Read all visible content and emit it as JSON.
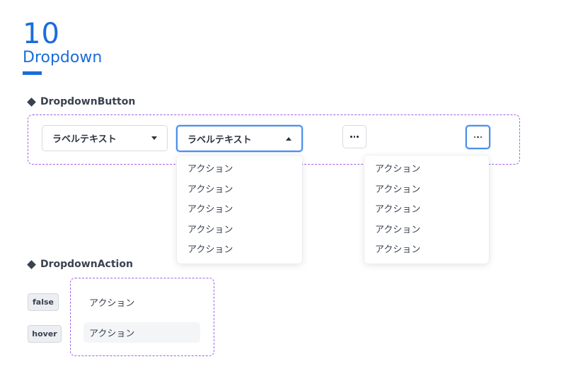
{
  "header": {
    "number": "10",
    "title": "Dropdown"
  },
  "sections": {
    "dropdown_button": {
      "heading": "DropdownButton"
    },
    "dropdown_action": {
      "heading": "DropdownAction"
    }
  },
  "dropdown_buttons": {
    "default": {
      "label": "ラベルテキスト",
      "state": "closed"
    },
    "open": {
      "label": "ラベルテキスト",
      "state": "open"
    }
  },
  "menus": {
    "label_menu": [
      "アクション",
      "アクション",
      "アクション",
      "アクション",
      "アクション"
    ],
    "more_menu": [
      "アクション",
      "アクション",
      "アクション",
      "アクション",
      "アクション"
    ]
  },
  "dropdown_action": {
    "states": [
      {
        "badge": "false",
        "label": "アクション"
      },
      {
        "badge": "hover",
        "label": "アクション"
      }
    ]
  },
  "colors": {
    "accent": "#1a6cdc",
    "frame": "#a560e8",
    "focus": "#4a8fe8"
  },
  "icons": {
    "more": "more-horizontal-icon",
    "caret_down": "caret-down-icon",
    "caret_up": "caret-up-icon",
    "bullet": "diamond-icon"
  }
}
